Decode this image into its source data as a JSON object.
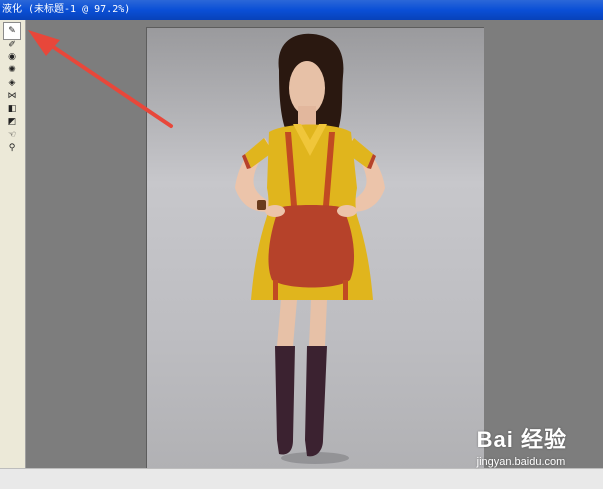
{
  "window": {
    "title": "液化 (未标题-1 @ 97.2%)"
  },
  "toolbox": {
    "tools": [
      {
        "name": "forward-warp-tool",
        "glyph": "✎",
        "active": true
      },
      {
        "name": "reconstruct-tool",
        "glyph": "✐"
      },
      {
        "name": "twirl-clockwise-tool",
        "glyph": "◉"
      },
      {
        "name": "pucker-tool",
        "glyph": "✺"
      },
      {
        "name": "bloat-tool",
        "glyph": "◈"
      },
      {
        "name": "push-left-tool",
        "glyph": "⋈"
      },
      {
        "name": "freeze-mask-tool",
        "glyph": "◧"
      },
      {
        "name": "thaw-mask-tool",
        "glyph": "◩"
      },
      {
        "name": "hand-tool",
        "glyph": "☜"
      },
      {
        "name": "zoom-tool",
        "glyph": "⚲"
      }
    ]
  },
  "watermark": {
    "logo_text": "Bai 经验",
    "url": "jingyan.baidu.com"
  },
  "colors": {
    "annotation_arrow": "#e8473a",
    "titlebar": "#0a4fd6",
    "dress": "#e0b51d",
    "apron": "#b6422a"
  }
}
